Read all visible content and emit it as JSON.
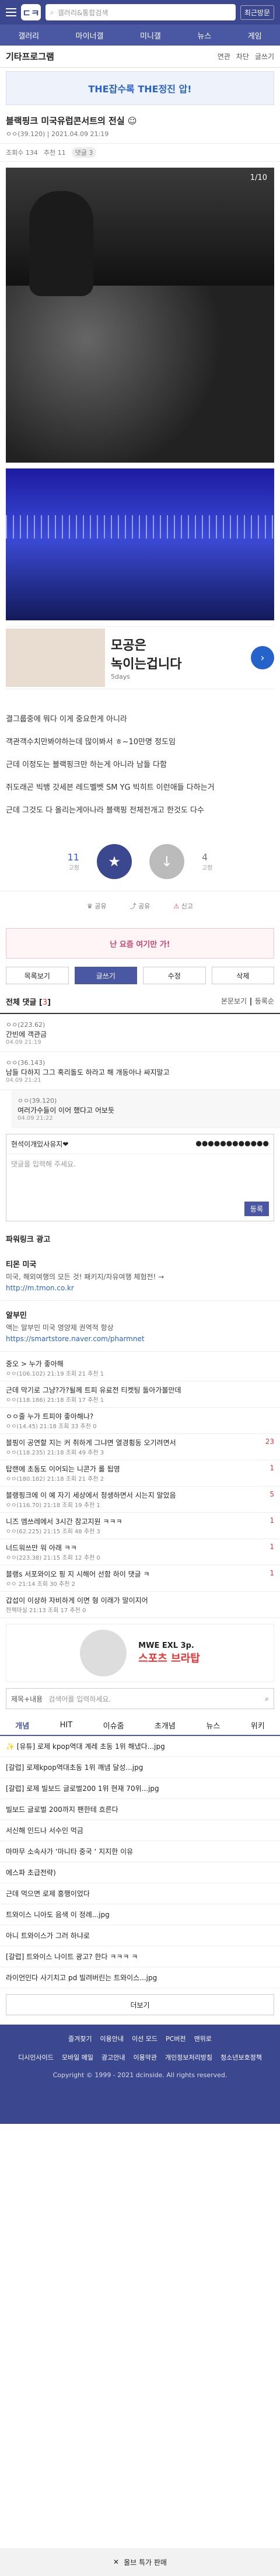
{
  "header": {
    "logo": "ㄷㅋ",
    "search_placeholder": "갤러리&통합검색",
    "right_btn": "최근방문"
  },
  "nav": [
    "갤러리",
    "마이너갤",
    "미니갤",
    "뉴스",
    "게임"
  ],
  "gallery": {
    "title": "기타프로그램",
    "links": [
      "연관",
      "차단",
      "글쓰기"
    ]
  },
  "banner_top": "THE잡수록 THE정진 압!",
  "post": {
    "title": "블랙핑크 미국유럽콘서트의 전실 ☺",
    "author": "ㅇㅇ(39.120)",
    "date": "2021.04.09 21:19",
    "views": "조회수 134",
    "rec": "추천 11",
    "cmt": "댓글 3",
    "img_counter": "1/10"
  },
  "ad1": {
    "line1": "모공은",
    "line2": "녹이는겁니다",
    "sub": "5days"
  },
  "body": [
    "결그룹중에 뭐다 이게 중요한게 아니라",
    "객관객수치만봐야하는데 많이봐서 ㅎ~10만명 정도임",
    "근데 이정도는 블랙핑크만 하는게 아니라 남들 다함",
    "쥐도래곤 빅뱅 갓세븐 레드벨벳 SM YG 빅히트 이런애들 다하는거",
    "근데 그것도 다 올리는게아나라 블랙핑 전체전개고 한것도 다수"
  ],
  "vote": {
    "up": "11",
    "down": "4",
    "up_sub": "고정",
    "down_sub": "고정"
  },
  "acts": [
    "공유",
    "공유",
    "신고"
  ],
  "banner2": "난 요즘 여기만 가!",
  "tabs": [
    "목록보기",
    "글쓰기",
    "수정",
    "삭제"
  ],
  "comment_head": {
    "title": "전체 댓글",
    "count": "3",
    "sort": "본문보기",
    "reg": "등록순"
  },
  "comments": [
    {
      "name": "ㅇㅇ(223.62)",
      "text": "간빈에 객관금",
      "time": "04.09 21:19"
    },
    {
      "name": "ㅇㅇ(36.143)",
      "text": "남들 다하지 그그 혹리돌도 하라고 해 개동아나 싸지말고",
      "time": "04.09 21:21"
    },
    {
      "name": "ㅇㅇ(39.120)",
      "text": "여러가수들이 이어 했다고 어보듯",
      "time": "04.09 21:22"
    }
  ],
  "cbox": {
    "id": "현석이개있사유지❤",
    "pw": "●●●●●●●●●●●●",
    "placeholder": "댓글을 입력해 주세요.",
    "submit": "등록"
  },
  "powerlink": {
    "title": "파워링크 광고",
    "items": [
      {
        "t": "티몬 미국",
        "d": "미국, 해외여행의 모든 것! 패키지/자유여행 체험전! →",
        "u": "http://m.tmon.co.kr"
      },
      {
        "t": "알부민",
        "d": "액는 알부민 미국 영양제 권역적 항상",
        "u": "https://smartstore.naver.com/pharmnet"
      }
    ]
  },
  "board": [
    {
      "t": "중오 > 누가 좋아해",
      "m": "ㅇㅇ(106.102) 21:19 조회 21 추천 1",
      "c": ""
    },
    {
      "t": "근데 막기로 그냥?가?될께 트피 유료전 티켓팅 돌아가볼만데",
      "m": "ㅇㅇ(118.186) 21:18 조회 17 추천 1",
      "c": ""
    },
    {
      "t": "ㅇㅇ줄 누가 트피야 좋아해나?",
      "m": "ㅇㅇ(14.45) 21:18 조회 33 추천 0",
      "c": ""
    },
    {
      "t": "블핑이 공연할 지는 커 취하게 그냐면 열경횡동 오기려면서",
      "m": "ㅇㅇ(118.235) 21:18 조회 49 추천 3",
      "c": "23"
    },
    {
      "t": "탑랜에 초동도 이어되는 니콘가 롤 됩영",
      "m": "ㅇㅇ(180.182) 21:18 조회 21 추천 2",
      "c": "1"
    },
    {
      "t": "블랭핑크에 이 예 자기 세상에서 청생하면서 시는지 알았음",
      "m": "ㅇㅇ(116.70) 21:18 조회 19 추천 1",
      "c": "5"
    },
    {
      "t": "니즈 엠쓰레에서 3시간 참고지원 ㅋㅋㅋ",
      "m": "ㅇㅇ(62.225) 21:15 조회 48 추천 3",
      "c": "1"
    },
    {
      "t": "너드워쓰만 워 아래 ㅋㅋ",
      "m": "ㅇㅇ(223.38) 21:15 조회 12 추천 0",
      "c": "1"
    },
    {
      "t": "블랭s 서포와이오 핑 지 시해어 선함 하이 댓글 ㅋ",
      "m": "ㅇㅇ 21:14 조회 30 추천 2",
      "c": "1"
    },
    {
      "t": "갑섭이 이상하 자비하게 이면 형 이래가 말이지어",
      "m": "전책마실 21:13 조회 17 추천 0",
      "c": ""
    }
  ],
  "ad2": {
    "t": "MWE EXL 3p.",
    "r": "스포츠 브라탑"
  },
  "search": {
    "scope": "제목+내용",
    "placeholder": "검색어를 입력하세요."
  },
  "rtabs": [
    "개념",
    "HIT",
    "이슈줌",
    "초개념",
    "뉴스",
    "위키"
  ],
  "rlist": [
    "✨ [유튜] 로제 kpop역대 계레 초동 1위 해냈다...jpg",
    "[갈럽] 로제kpop역대초동 1위 깨냄 달성...jpg",
    "[갈럽] 로제 빌보드 글로벌200 1위 현재 70위...jpg",
    "빌보드 글로벌 200까지 팬한테 흐른다",
    "서신해 인드나 서수인 먹금",
    "마마무 소속사가 ‘마니타 중국 ‘ 지지한 이유",
    "에스파 초급전략)",
    "근데 먹으면 로제 흥행이었다",
    "트와이스 니아도 음색 이 정례...jpg",
    "아니 트와이스가 그러 하냐로",
    "[갈럽] 트와이스 나이트 광고? 한다 ㅋㅋㅋ ㅋ",
    "라이언인다 사기치고 pd 빌려버린는 트와이스...jpg"
  ],
  "more": "더보기",
  "footer": {
    "r1": [
      "즐겨찾기",
      "이용안내",
      "이선 모드",
      "PC버전",
      "맨위로"
    ],
    "r2": [
      "디시인사이드",
      "모바일 메일",
      "광고안내",
      "이용약관",
      "개인정보처리방침",
      "청소년보호정책"
    ],
    "copy": "Copyright © 1999 - 2021 dcinside. All rights reserved."
  },
  "bottom_ad": "올브 특가 판매"
}
